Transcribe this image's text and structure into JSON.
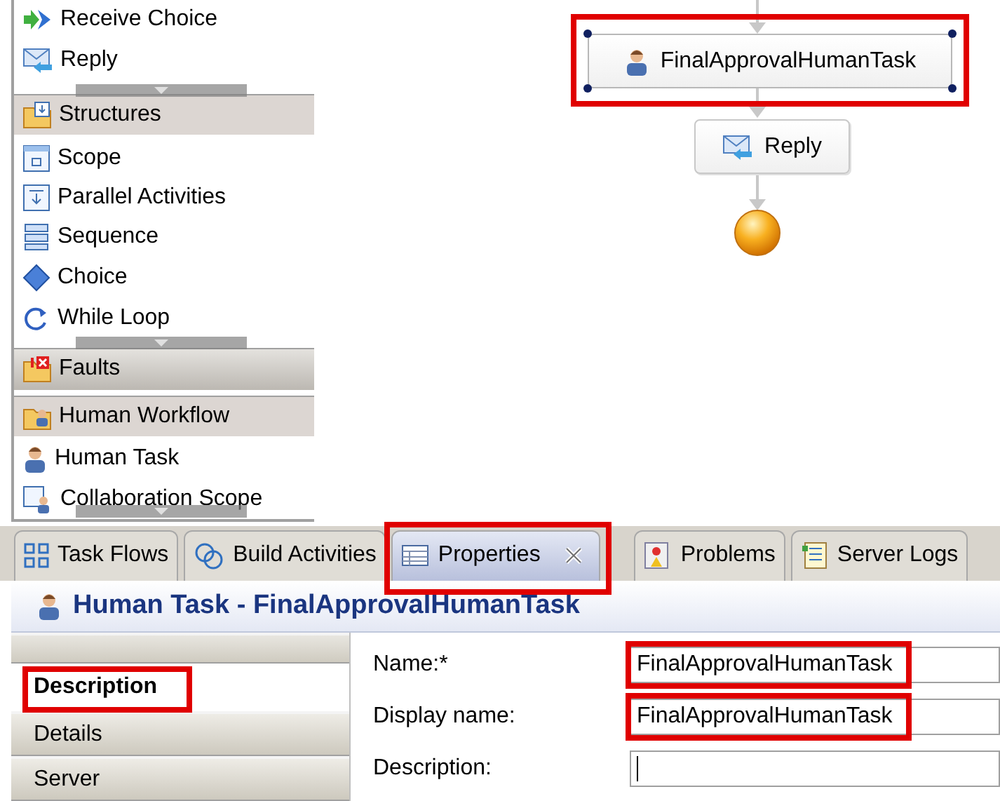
{
  "palette": {
    "items": [
      {
        "kind": "item",
        "label": "Receive Choice"
      },
      {
        "kind": "item",
        "label": "Reply"
      },
      {
        "kind": "drawer",
        "label": "Structures"
      },
      {
        "kind": "item",
        "label": "Scope"
      },
      {
        "kind": "item",
        "label": "Parallel Activities"
      },
      {
        "kind": "item",
        "label": "Sequence"
      },
      {
        "kind": "item",
        "label": "Choice"
      },
      {
        "kind": "item",
        "label": "While Loop"
      },
      {
        "kind": "drawer",
        "label": "Faults",
        "selected": true
      },
      {
        "kind": "drawer",
        "label": "Human Workflow",
        "selected": false
      },
      {
        "kind": "item",
        "label": "Human Task"
      },
      {
        "kind": "item",
        "label": "Collaboration Scope"
      }
    ]
  },
  "diagram": {
    "nodes": [
      {
        "label": "FinalApprovalHumanTask",
        "selected": true,
        "highlighted": true
      },
      {
        "label": "Reply",
        "selected": false,
        "highlighted": false
      }
    ]
  },
  "tabs": [
    {
      "label": "Task Flows",
      "selected": false,
      "highlighted": false
    },
    {
      "label": "Build Activities",
      "selected": false,
      "highlighted": false
    },
    {
      "label": "Properties",
      "selected": true,
      "highlighted": true
    },
    {
      "label": "Problems",
      "selected": false,
      "highlighted": false
    },
    {
      "label": "Server Logs",
      "selected": false,
      "highlighted": false
    }
  ],
  "editor_title": "Human Task - FinalApprovalHumanTask",
  "property_tabs": [
    {
      "label": "Description",
      "selected": true,
      "highlighted": true
    },
    {
      "label": "Details",
      "selected": false,
      "highlighted": false
    },
    {
      "label": "Server",
      "selected": false,
      "highlighted": false
    }
  ],
  "fields": [
    {
      "label": "Name:*",
      "value": "FinalApprovalHumanTask",
      "highlighted": true
    },
    {
      "label": "Display name:",
      "value": "FinalApprovalHumanTask",
      "highlighted": true
    },
    {
      "label": "Description:",
      "focused": true,
      "highlighted": false
    }
  ]
}
